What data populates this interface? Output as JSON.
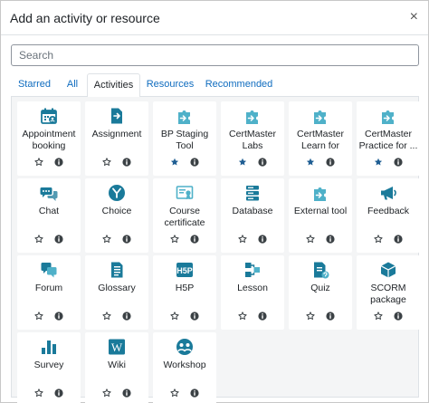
{
  "dialog": {
    "title": "Add an activity or resource",
    "close_glyph": "×"
  },
  "search": {
    "placeholder": "Search"
  },
  "tabs": [
    {
      "label": "Starred"
    },
    {
      "label": "All"
    },
    {
      "label": "Activities",
      "active": true
    },
    {
      "label": "Resources"
    },
    {
      "label": "Recommended"
    }
  ],
  "colors": {
    "icon": "#1a7a9a",
    "link": "#0f6cbf",
    "starred": "#1f5e93"
  },
  "activities": [
    {
      "label": "Appointment booking",
      "icon": "appointment-icon",
      "starred": false
    },
    {
      "label": "Assignment",
      "icon": "assignment-icon",
      "starred": false
    },
    {
      "label": "BP Staging Tool",
      "icon": "puzzle-icon",
      "starred": true
    },
    {
      "label": "CertMaster Labs",
      "icon": "puzzle-icon",
      "starred": true
    },
    {
      "label": "CertMaster Learn for A+...",
      "icon": "puzzle-icon",
      "starred": true
    },
    {
      "label": "CertMaster Practice for ...",
      "icon": "puzzle-icon",
      "starred": true
    },
    {
      "label": "Chat",
      "icon": "chat-icon",
      "starred": false
    },
    {
      "label": "Choice",
      "icon": "choice-icon",
      "starred": false
    },
    {
      "label": "Course certificate",
      "icon": "certificate-icon",
      "starred": false
    },
    {
      "label": "Database",
      "icon": "database-icon",
      "starred": false
    },
    {
      "label": "External tool",
      "icon": "puzzle-icon",
      "starred": false
    },
    {
      "label": "Feedback",
      "icon": "megaphone-icon",
      "starred": false
    },
    {
      "label": "Forum",
      "icon": "forum-icon",
      "starred": false
    },
    {
      "label": "Glossary",
      "icon": "glossary-icon",
      "starred": false
    },
    {
      "label": "H5P",
      "icon": "h5p-icon",
      "starred": false
    },
    {
      "label": "Lesson",
      "icon": "lesson-icon",
      "starred": false
    },
    {
      "label": "Quiz",
      "icon": "quiz-icon",
      "starred": false
    },
    {
      "label": "SCORM package",
      "icon": "scorm-icon",
      "starred": false
    },
    {
      "label": "Survey",
      "icon": "survey-icon",
      "starred": false
    },
    {
      "label": "Wiki",
      "icon": "wiki-icon",
      "starred": false
    },
    {
      "label": "Workshop",
      "icon": "workshop-icon",
      "starred": false
    }
  ]
}
